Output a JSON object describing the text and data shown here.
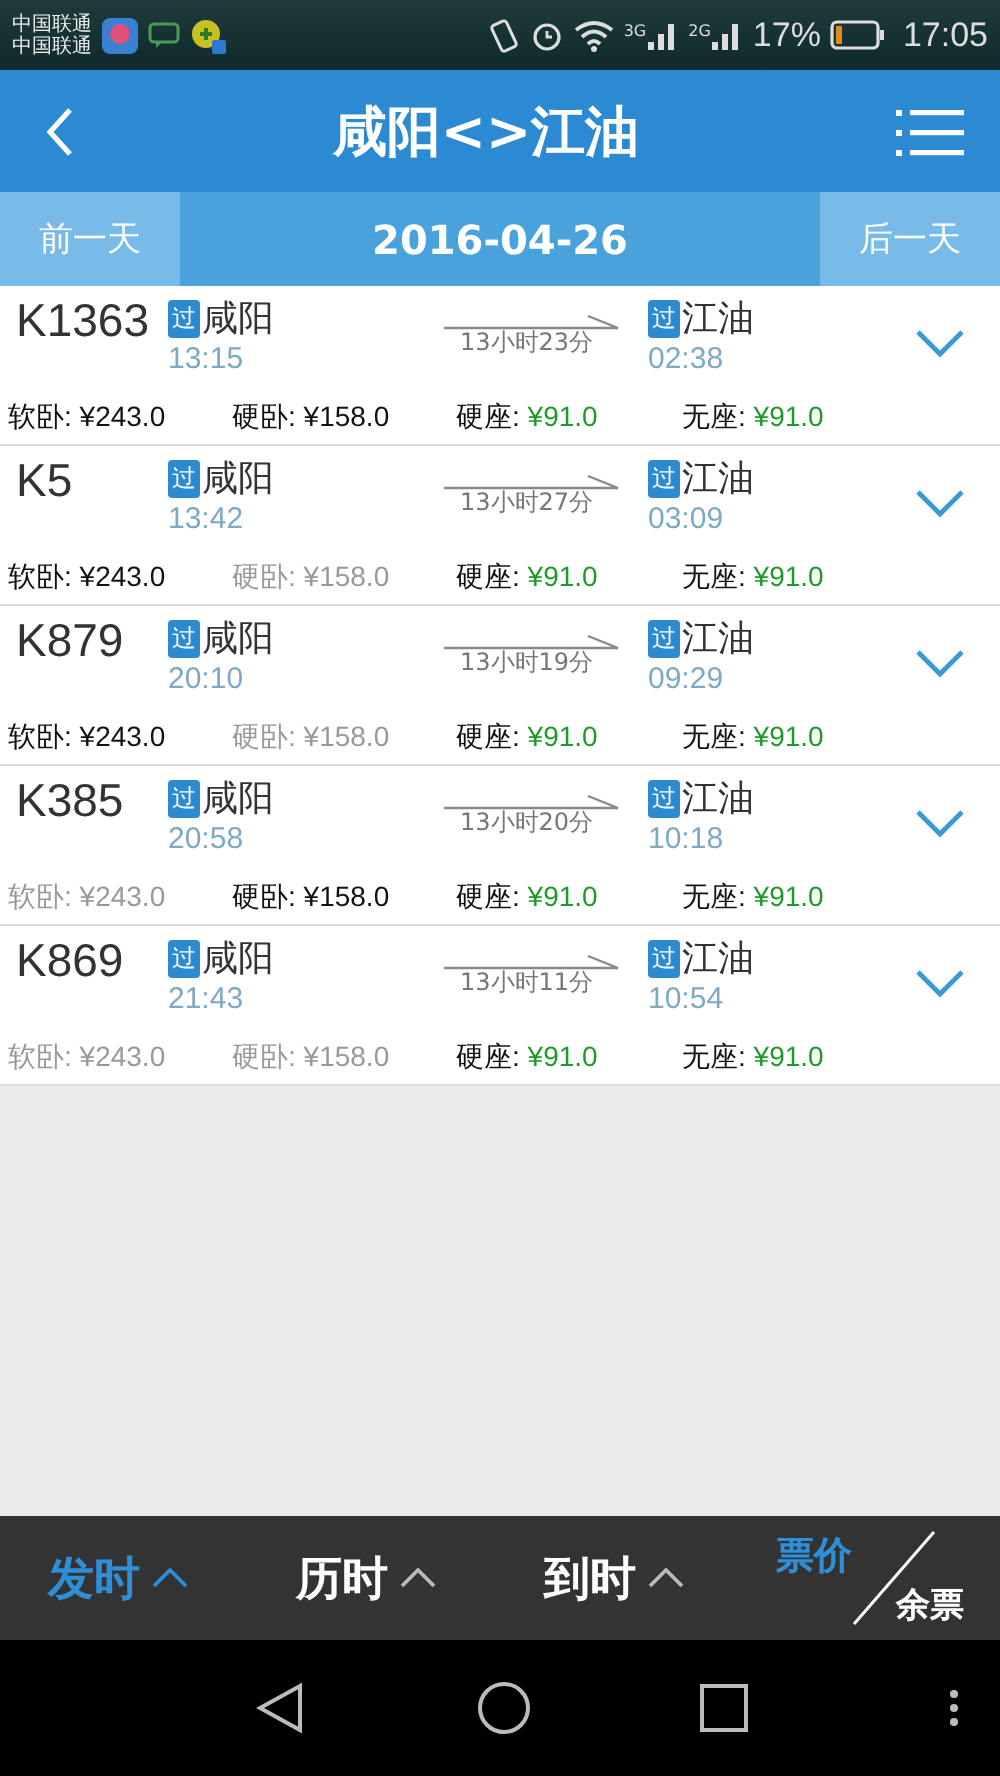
{
  "status_bar": {
    "carriers": [
      "中国联通",
      "中国联通"
    ],
    "network_labels": [
      "3G",
      "2G"
    ],
    "battery": "17%",
    "time": "17:05"
  },
  "header": {
    "title": "咸阳<>江油"
  },
  "date_bar": {
    "prev": "前一天",
    "date": "2016-04-26",
    "next": "后一天"
  },
  "trains": [
    {
      "number": "K1363",
      "from_badge": "过",
      "from": "咸阳",
      "depart": "13:15",
      "duration": "13小时23分",
      "to_badge": "过",
      "to": "江油",
      "arrive": "02:38",
      "fares": [
        {
          "label": "软卧:",
          "price": "¥243.0",
          "kind": "few"
        },
        {
          "label": "硬卧:",
          "price": "¥158.0",
          "kind": "few"
        },
        {
          "label": "硬座:",
          "price": "¥91.0",
          "kind": "many"
        },
        {
          "label": "无座:",
          "price": "¥91.0",
          "kind": "many"
        }
      ]
    },
    {
      "number": "K5",
      "from_badge": "过",
      "from": "咸阳",
      "depart": "13:42",
      "duration": "13小时27分",
      "to_badge": "过",
      "to": "江油",
      "arrive": "03:09",
      "fares": [
        {
          "label": "软卧:",
          "price": "¥243.0",
          "kind": "few"
        },
        {
          "label": "硬卧:",
          "price": "¥158.0",
          "kind": "none"
        },
        {
          "label": "硬座:",
          "price": "¥91.0",
          "kind": "many"
        },
        {
          "label": "无座:",
          "price": "¥91.0",
          "kind": "many"
        }
      ]
    },
    {
      "number": "K879",
      "from_badge": "过",
      "from": "咸阳",
      "depart": "20:10",
      "duration": "13小时19分",
      "to_badge": "过",
      "to": "江油",
      "arrive": "09:29",
      "fares": [
        {
          "label": "软卧:",
          "price": "¥243.0",
          "kind": "few"
        },
        {
          "label": "硬卧:",
          "price": "¥158.0",
          "kind": "none"
        },
        {
          "label": "硬座:",
          "price": "¥91.0",
          "kind": "many"
        },
        {
          "label": "无座:",
          "price": "¥91.0",
          "kind": "many"
        }
      ]
    },
    {
      "number": "K385",
      "from_badge": "过",
      "from": "咸阳",
      "depart": "20:58",
      "duration": "13小时20分",
      "to_badge": "过",
      "to": "江油",
      "arrive": "10:18",
      "fares": [
        {
          "label": "软卧:",
          "price": "¥243.0",
          "kind": "none"
        },
        {
          "label": "硬卧:",
          "price": "¥158.0",
          "kind": "few"
        },
        {
          "label": "硬座:",
          "price": "¥91.0",
          "kind": "many"
        },
        {
          "label": "无座:",
          "price": "¥91.0",
          "kind": "many"
        }
      ]
    },
    {
      "number": "K869",
      "from_badge": "过",
      "from": "咸阳",
      "depart": "21:43",
      "duration": "13小时11分",
      "to_badge": "过",
      "to": "江油",
      "arrive": "10:54",
      "fares": [
        {
          "label": "软卧:",
          "price": "¥243.0",
          "kind": "none"
        },
        {
          "label": "硬卧:",
          "price": "¥158.0",
          "kind": "none"
        },
        {
          "label": "硬座:",
          "price": "¥91.0",
          "kind": "many"
        },
        {
          "label": "无座:",
          "price": "¥91.0",
          "kind": "many"
        }
      ]
    }
  ],
  "sort_bar": {
    "items": [
      {
        "label": "发时",
        "selected": true
      },
      {
        "label": "历时",
        "selected": false
      },
      {
        "label": "到时",
        "selected": false
      }
    ],
    "split": [
      {
        "label": "票价",
        "selected": true
      },
      {
        "label": "余票",
        "selected": false
      }
    ]
  }
}
